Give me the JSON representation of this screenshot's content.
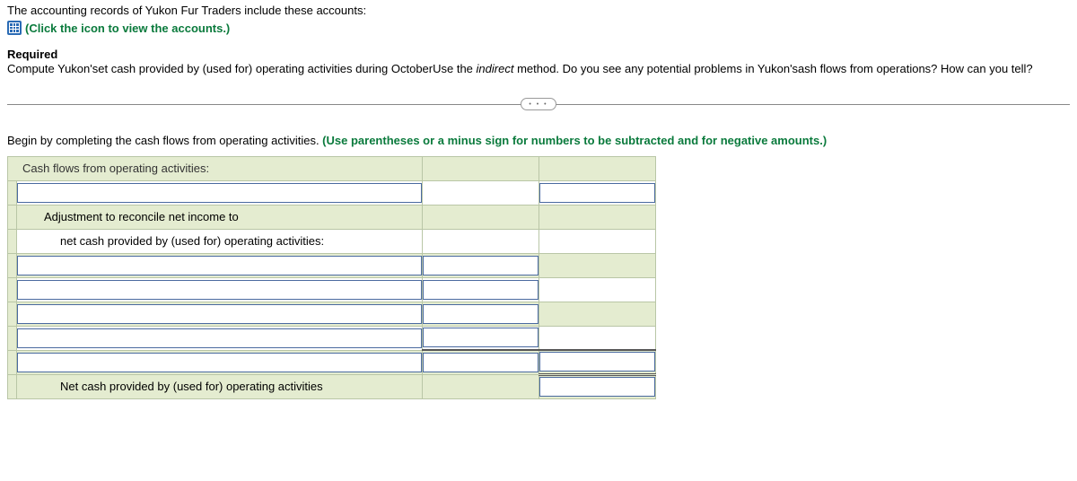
{
  "intro": "The accounting records of Yukon Fur Traders include these accounts:",
  "clickLink": "(Click the icon to view the accounts.)",
  "requiredHead": "Required",
  "requirement": {
    "part1": "Compute Yukon'set cash provided by (used for) operating activities during OctoberUse the ",
    "italic": "indirect",
    "part2": " method. Do you see any potential problems in Yukon'sash flows from operations? How can you tell?"
  },
  "dots": "• • •",
  "instruction": {
    "plain": "Begin by completing the cash flows from operating activities. ",
    "green": "(Use parentheses or a minus sign for numbers to be subtracted and for negative amounts.)"
  },
  "rows": {
    "header": "Cash flows from operating activities:",
    "adjust1": "Adjustment to reconcile net income to",
    "adjust2": "net cash provided by (used for) operating activities:",
    "netcash": "Net cash provided by (used for) operating activities"
  }
}
